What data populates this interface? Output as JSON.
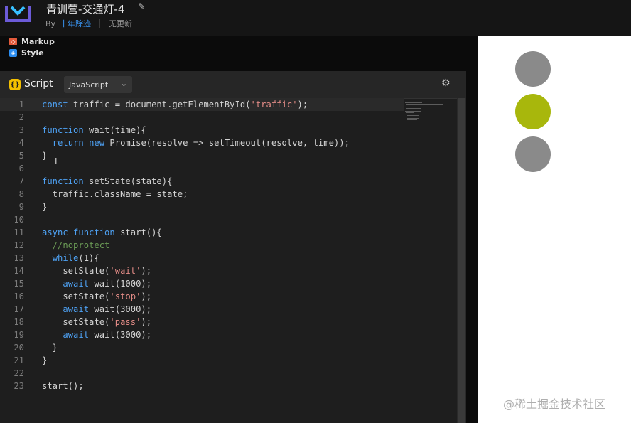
{
  "header": {
    "title": "青训营-交通灯-4",
    "by_label": "By",
    "author": "十年踪迹",
    "update_status": "无更新"
  },
  "tabs": [
    {
      "label": "Markup"
    },
    {
      "label": "Style"
    }
  ],
  "script_panel": {
    "label": "Script",
    "language": "JavaScript",
    "lines": [
      {
        "n": "1",
        "text": "const traffic = document.getElementById('traffic');"
      },
      {
        "n": "2",
        "text": ""
      },
      {
        "n": "3",
        "text": "function wait(time){"
      },
      {
        "n": "4",
        "text": "  return new Promise(resolve => setTimeout(resolve, time));"
      },
      {
        "n": "5",
        "text": "}"
      },
      {
        "n": "6",
        "text": ""
      },
      {
        "n": "7",
        "text": "function setState(state){"
      },
      {
        "n": "8",
        "text": "  traffic.className = state;"
      },
      {
        "n": "9",
        "text": "}"
      },
      {
        "n": "10",
        "text": ""
      },
      {
        "n": "11",
        "text": "async function start(){"
      },
      {
        "n": "12",
        "text": "  //noprotect"
      },
      {
        "n": "13",
        "text": "  while(1){"
      },
      {
        "n": "14",
        "text": "    setState('wait');"
      },
      {
        "n": "15",
        "text": "    await wait(1000);"
      },
      {
        "n": "16",
        "text": "    setState('stop');"
      },
      {
        "n": "17",
        "text": "    await wait(3000);"
      },
      {
        "n": "18",
        "text": "    setState('pass');"
      },
      {
        "n": "19",
        "text": "    await wait(3000);"
      },
      {
        "n": "20",
        "text": "  }"
      },
      {
        "n": "21",
        "text": "}"
      },
      {
        "n": "22",
        "text": ""
      },
      {
        "n": "23",
        "text": "start();"
      }
    ]
  },
  "preview": {
    "lights": [
      {
        "state": "off",
        "color": "#8a8a8a"
      },
      {
        "state": "on",
        "color": "#a8b70c"
      },
      {
        "state": "off",
        "color": "#8a8a8a"
      }
    ]
  },
  "watermark": "@稀土掘金技术社区"
}
